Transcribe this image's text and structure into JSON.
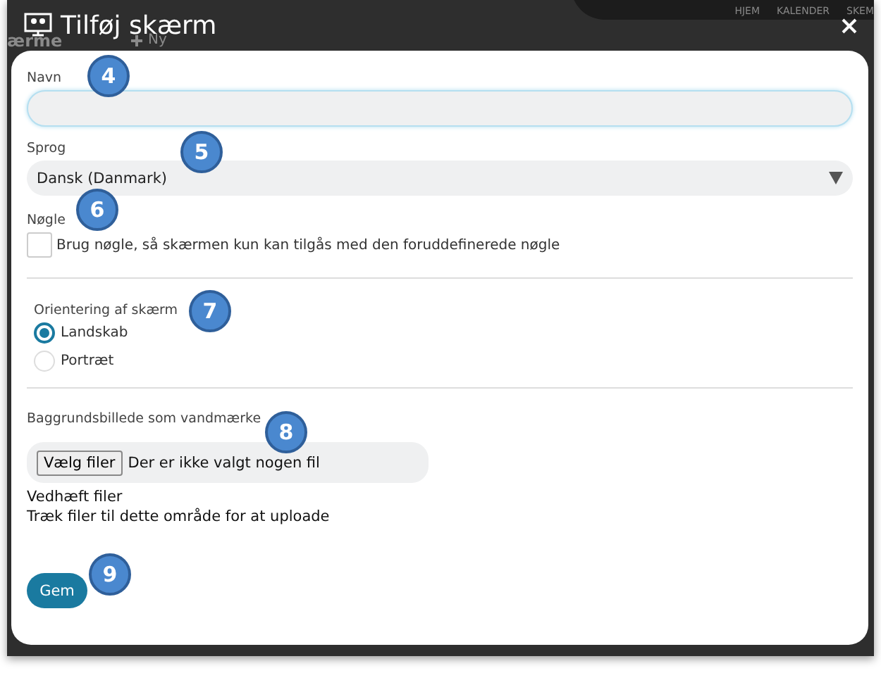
{
  "background": {
    "page_title": "ærme",
    "new_button": "Ny",
    "nav": [
      "HJEM",
      "KALENDER",
      "SKEM"
    ]
  },
  "window": {
    "title": "Tilføj skærm"
  },
  "name_field": {
    "label": "Navn",
    "badge": "4"
  },
  "language": {
    "label": "Sprog",
    "value": "Dansk (Danmark)",
    "badge": "5"
  },
  "key": {
    "label": "Nøgle",
    "checkbox_label": "Brug nøgle, så skærmen kun kan tilgås med den foruddefinerede nøgle",
    "checked": false,
    "badge": "6"
  },
  "orientation": {
    "label": "Orientering af skærm",
    "badge": "7",
    "options": [
      {
        "label": "Landskab",
        "selected": true
      },
      {
        "label": "Portræt",
        "selected": false
      }
    ]
  },
  "watermark": {
    "label": "Baggrundsbillede som vandmærke",
    "badge": "8",
    "button": "Vælg filer",
    "status": "Der er ikke valgt nogen fil"
  },
  "attachments": {
    "title": "Vedhæft filer",
    "hint": "Træk filer til dette område for at uploade"
  },
  "save": {
    "label": "Gem",
    "badge": "9"
  }
}
